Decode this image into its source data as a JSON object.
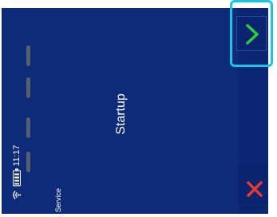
{
  "status": {
    "time": "11:17",
    "battery_icon": "battery-icon",
    "signal_icon": "wifi-icon"
  },
  "main": {
    "title": "Startup",
    "service_label": "Service",
    "progress_segments": 4
  },
  "buttons": {
    "next_icon": "chevron-right-icon",
    "close_icon": "close-icon"
  },
  "colors": {
    "background": "#0d2b78",
    "next_accent": "#2ecc40",
    "close_accent": "#e53935",
    "highlight": "#18c6e6"
  }
}
